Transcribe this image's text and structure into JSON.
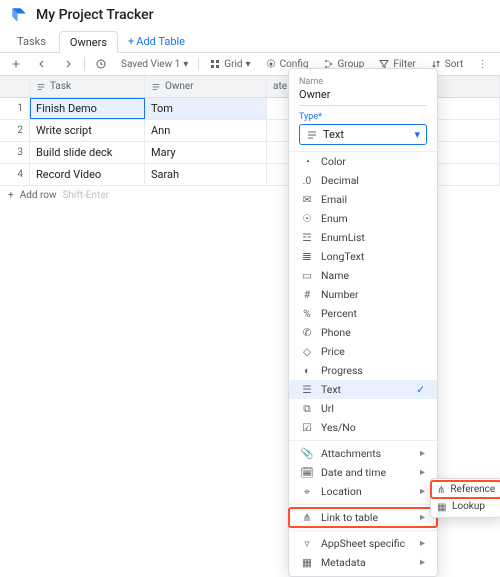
{
  "header": {
    "title": "My Project Tracker"
  },
  "tabs": {
    "task": "Tasks",
    "owners": "Owners",
    "add": "Add Table"
  },
  "toolbar": {
    "view": "Saved View 1",
    "grid": "Grid",
    "config": "Config",
    "group": "Group",
    "filter": "Filter",
    "sort": "Sort"
  },
  "columns": {
    "task": "Task",
    "owner": "Owner",
    "date": "ate"
  },
  "rows": [
    {
      "n": "1",
      "task": "Finish Demo",
      "owner": "Tom"
    },
    {
      "n": "2",
      "task": "Write script",
      "owner": "Ann"
    },
    {
      "n": "3",
      "task": "Build slide deck",
      "owner": "Mary"
    },
    {
      "n": "4",
      "task": "Record Video",
      "owner": "Sarah"
    }
  ],
  "addRow": {
    "label": "Add row",
    "hint": "Shift-Enter"
  },
  "panel": {
    "nameLabel": "Name",
    "name": "Owner",
    "typeLabel": "Type*",
    "typeValue": "Text",
    "options": {
      "color": "Color",
      "decimal": "Decimal",
      "email": "Email",
      "enum": "Enum",
      "enumlist": "EnumList",
      "longtext": "LongText",
      "name": "Name",
      "number": "Number",
      "percent": "Percent",
      "phone": "Phone",
      "price": "Price",
      "progress": "Progress",
      "text": "Text",
      "url": "Url",
      "yesno": "Yes/No",
      "attachments": "Attachments",
      "datetime": "Date and time",
      "location": "Location",
      "link": "Link to table",
      "appsheet": "AppSheet specific",
      "metadata": "Metadata"
    }
  },
  "submenu": {
    "reference": "Reference",
    "lookup": "Lookup"
  }
}
